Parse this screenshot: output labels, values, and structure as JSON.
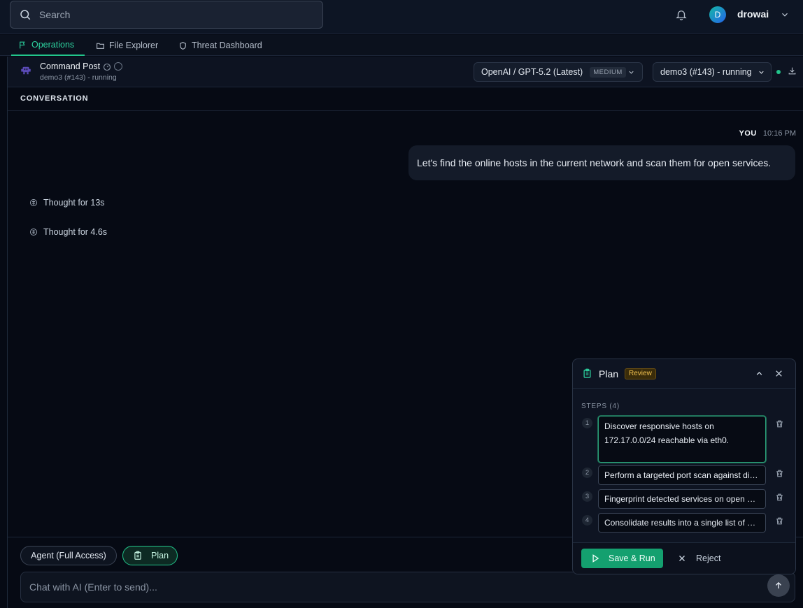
{
  "search": {
    "placeholder": "Search"
  },
  "user": {
    "initial": "D",
    "name": "drowai"
  },
  "tabs": [
    {
      "label": "Operations",
      "icon": "flag-icon",
      "active": true
    },
    {
      "label": "File Explorer",
      "icon": "folder-icon"
    },
    {
      "label": "Threat Dashboard",
      "icon": "shield-icon"
    }
  ],
  "header": {
    "title": "Command Post",
    "subtitle": "demo3 (#143) - running",
    "model_select": "OpenAI / GPT-5.2 (Latest)",
    "model_effort": "MEDIUM",
    "session_select": "demo3 (#143) - running"
  },
  "conversation": {
    "label": "CONVERSATION",
    "messages": [
      {
        "author": "YOU",
        "time": "10:16 PM",
        "text": "Let's find the online hosts in the current network and scan them for open services."
      }
    ],
    "thoughts": [
      "Thought for 13s",
      "Thought for 4.6s"
    ]
  },
  "composer": {
    "mode_agent": "Agent (Full Access)",
    "mode_plan": "Plan",
    "placeholder": "Chat with AI (Enter to send)..."
  },
  "plan": {
    "title": "Plan",
    "badge": "Review",
    "steps_label": "STEPS (4)",
    "steps": [
      {
        "num": "1",
        "text": "Discover responsive hosts on 172.17.0.0/24 reachable via eth0."
      },
      {
        "num": "2",
        "text": "Perform a targeted port scan against discovered hosts"
      },
      {
        "num": "3",
        "text": "Fingerprint detected services on open ports"
      },
      {
        "num": "4",
        "text": "Consolidate results into a single list of hosts and services"
      }
    ],
    "save_label": "Save & Run",
    "reject_label": "Reject"
  },
  "colors": {
    "accent": "#22c58b",
    "badge": "#f5c451",
    "background": "#060a14"
  }
}
